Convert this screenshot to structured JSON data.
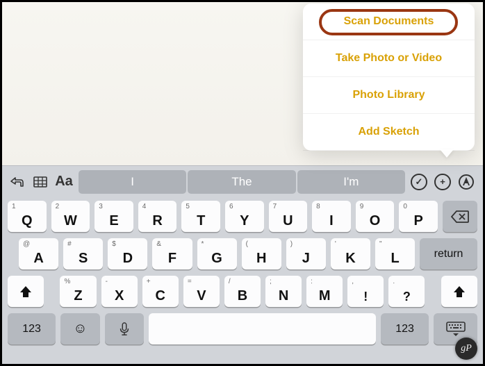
{
  "popover": {
    "items": [
      {
        "label": "Scan Documents"
      },
      {
        "label": "Take Photo or Video"
      },
      {
        "label": "Photo Library"
      },
      {
        "label": "Add Sketch"
      }
    ]
  },
  "toolbar": {
    "format_label": "Aa"
  },
  "suggestions": [
    "I",
    "The",
    "I'm"
  ],
  "keys_row1": [
    {
      "main": "Q",
      "sub": "1"
    },
    {
      "main": "W",
      "sub": "2"
    },
    {
      "main": "E",
      "sub": "3"
    },
    {
      "main": "R",
      "sub": "4"
    },
    {
      "main": "T",
      "sub": "5"
    },
    {
      "main": "Y",
      "sub": "6"
    },
    {
      "main": "U",
      "sub": "7"
    },
    {
      "main": "I",
      "sub": "8"
    },
    {
      "main": "O",
      "sub": "9"
    },
    {
      "main": "P",
      "sub": "0"
    }
  ],
  "keys_row2": [
    {
      "main": "A",
      "sub": "@"
    },
    {
      "main": "S",
      "sub": "#"
    },
    {
      "main": "D",
      "sub": "$"
    },
    {
      "main": "F",
      "sub": "&"
    },
    {
      "main": "G",
      "sub": "*"
    },
    {
      "main": "H",
      "sub": "("
    },
    {
      "main": "J",
      "sub": ")"
    },
    {
      "main": "K",
      "sub": "'"
    },
    {
      "main": "L",
      "sub": "\""
    }
  ],
  "return_label": "return",
  "keys_row3": [
    {
      "main": "Z",
      "sub": "%"
    },
    {
      "main": "X",
      "sub": "-"
    },
    {
      "main": "C",
      "sub": "+"
    },
    {
      "main": "V",
      "sub": "="
    },
    {
      "main": "B",
      "sub": "/"
    },
    {
      "main": "N",
      "sub": ";"
    },
    {
      "main": "M",
      "sub": ":"
    },
    {
      "main": "!",
      "sub": ","
    },
    {
      "main": "?",
      "sub": "."
    }
  ],
  "mode_label": "123",
  "watermark": "gP"
}
